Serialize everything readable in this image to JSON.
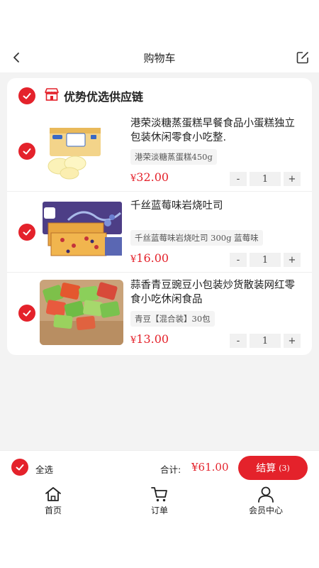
{
  "header": {
    "title": "购物车"
  },
  "store": {
    "name": "优势优选供应链"
  },
  "items": [
    {
      "title": "港荣淡糖蒸蛋糕早餐食品小蛋糕独立包装休闲零食小吃整.",
      "spec": "港荣淡糖蒸蛋糕450g",
      "price_symbol": "¥",
      "price": "32.00",
      "quantity": "1"
    },
    {
      "title": "千丝蓝莓味岩烧吐司",
      "spec": "千丝蓝莓味岩烧吐司 300g 蓝莓味",
      "price_symbol": "¥",
      "price": "16.00",
      "quantity": "1"
    },
    {
      "title": "蒜香青豆豌豆小包装炒货散装网红零食小吃休闲食品",
      "spec": "青豆【混合装】30包",
      "price_symbol": "¥",
      "price": "13.00",
      "quantity": "1"
    }
  ],
  "stepper": {
    "minus": "-",
    "plus": "+"
  },
  "footer": {
    "select_all": "全选",
    "total_label": "合计:",
    "total_value": "¥61.00",
    "checkout_label": "结算",
    "checkout_count": "(3)"
  },
  "tabbar": {
    "home": "首页",
    "orders": "订单",
    "member": "会员中心"
  },
  "colors": {
    "accent": "#e4222b",
    "background": "#f3f3f3"
  }
}
